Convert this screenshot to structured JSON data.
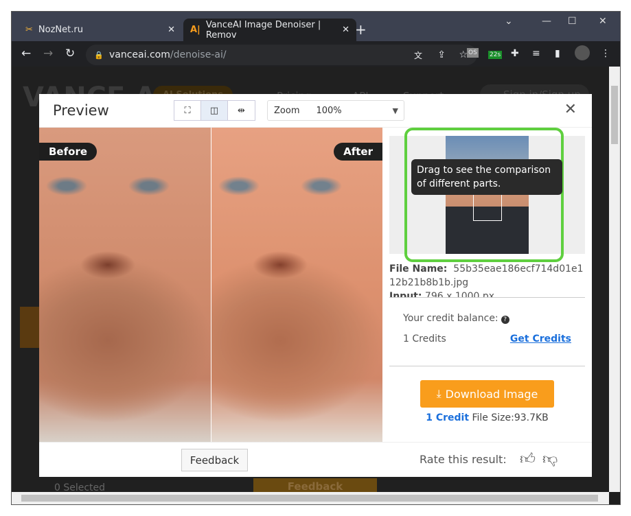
{
  "browser": {
    "tabs": [
      {
        "label": "NozNet.ru",
        "icon": "tools-icon"
      },
      {
        "label": "VanceAI Image Denoiser | Remov",
        "icon": "vanceai-icon",
        "active": true
      }
    ],
    "url_host": "vanceai.com",
    "url_path": "/denoise-ai/",
    "extension_badge": "22s"
  },
  "background_page": {
    "logo": "VANCE AI",
    "nav": [
      "AI Solutions",
      "Pricing",
      "API",
      "Support",
      "Sign in/Sign up"
    ],
    "selected": "0  Selected",
    "feedback": "Feedback"
  },
  "modal": {
    "title": "Preview",
    "view_modes": [
      "fullscreen",
      "split",
      "side-by-side"
    ],
    "active_view": "split",
    "zoom_label": "Zoom",
    "zoom_value": "100%",
    "before_label": "Before",
    "after_label": "After",
    "tooltip": "Drag to see the comparison of different parts.",
    "file_name_label": "File Name:",
    "file_name": "55b35eae186ecf714d01e112b21b8b1b.jpg",
    "input_label": "Input:",
    "input_value": "796 x 1000 px",
    "credit_balance_label": "Your credit balance:",
    "credits": "1 Credits",
    "get_credits": "Get Credits",
    "download": "Download Image",
    "credit_cost": "1 Credit",
    "file_size": "File Size:93.7KB",
    "feedback": "Feedback",
    "rate": "Rate this result:"
  },
  "colors": {
    "accent": "#f99d1c",
    "link": "#1a6fdc",
    "highlight": "#5fcf3f"
  }
}
